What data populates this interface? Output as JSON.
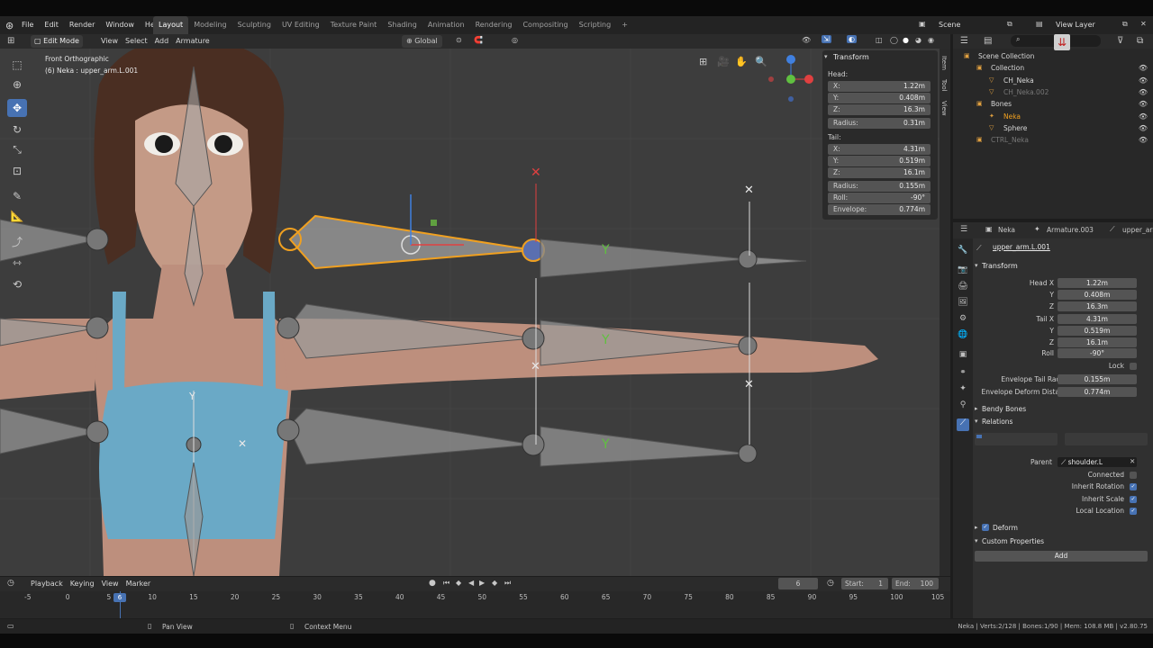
{
  "menubar": {
    "items": [
      "File",
      "Edit",
      "Render",
      "Window",
      "Help"
    ],
    "workspaces": [
      "Layout",
      "Modeling",
      "Sculpting",
      "UV Editing",
      "Texture Paint",
      "Shading",
      "Animation",
      "Rendering",
      "Compositing",
      "Scripting"
    ],
    "active_workspace": "Layout",
    "add_tab": "+",
    "scene_label": "Scene",
    "view_layer_label": "View Layer"
  },
  "viewport_header": {
    "mode": "Edit Mode",
    "menus": [
      "View",
      "Select",
      "Add",
      "Armature"
    ],
    "orientation": "Global"
  },
  "viewport": {
    "view_name": "Front Orthographic",
    "object_info": "(6) Neka : upper_arm.L.001",
    "side_tabs": [
      "Item",
      "Tool",
      "View"
    ]
  },
  "transform_panel": {
    "title": "Transform",
    "head_label": "Head:",
    "tail_label": "Tail:",
    "head": [
      {
        "label": "X:",
        "value": "1.22m"
      },
      {
        "label": "Y:",
        "value": "0.408m"
      },
      {
        "label": "Z:",
        "value": "16.3m"
      },
      {
        "label": "Radius:",
        "value": "0.31m"
      }
    ],
    "tail": [
      {
        "label": "X:",
        "value": "4.31m"
      },
      {
        "label": "Y:",
        "value": "0.519m"
      },
      {
        "label": "Z:",
        "value": "16.1m"
      },
      {
        "label": "Radius:",
        "value": "0.155m"
      },
      {
        "label": "Roll:",
        "value": "-90°"
      },
      {
        "label": "Envelope:",
        "value": "0.774m"
      }
    ]
  },
  "outliner": {
    "rows": [
      {
        "name": "Scene Collection",
        "indent": 0
      },
      {
        "name": "Collection",
        "indent": 1
      },
      {
        "name": "CH_Neka",
        "indent": 2
      },
      {
        "name": "CH_Neka.002",
        "indent": 2
      },
      {
        "name": "Bones",
        "indent": 1
      },
      {
        "name": "Neka",
        "indent": 2
      },
      {
        "name": "Sphere",
        "indent": 2
      },
      {
        "name": "CTRL_Neka",
        "indent": 1
      }
    ]
  },
  "properties": {
    "breadcrumb": [
      "Neka",
      "Armature.003",
      "upper_arm"
    ],
    "bone_name": "upper_arm.L.001",
    "transform_title": "Transform",
    "rows": [
      {
        "label": "Head X",
        "value": "1.22m"
      },
      {
        "label": "Y",
        "value": "0.408m"
      },
      {
        "label": "Z",
        "value": "16.3m"
      },
      {
        "label": "Tail X",
        "value": "4.31m"
      },
      {
        "label": "Y",
        "value": "0.519m"
      },
      {
        "label": "Z",
        "value": "16.1m"
      },
      {
        "label": "Roll",
        "value": "-90°"
      }
    ],
    "lock_label": "Lock",
    "envelope_tail_radius_label": "Envelope Tail Radius",
    "envelope_tail_radius": "0.155m",
    "envelope_deform_label": "Envelope Deform Distan...",
    "envelope_deform": "0.774m",
    "bendy_bones": "Bendy Bones",
    "relations": "Relations",
    "parent_label": "Parent",
    "parent_value": "shoulder.L",
    "connected": "Connected",
    "inherit_rotation": "Inherit Rotation",
    "inherit_scale": "Inherit Scale",
    "local_location": "Local Location",
    "deform": "Deform",
    "custom_properties": "Custom Properties",
    "add": "Add"
  },
  "timeline": {
    "menus": [
      "Playback",
      "Keying",
      "View",
      "Marker"
    ],
    "current_frame": "6",
    "start_label": "Start:",
    "start": "1",
    "end_label": "End:",
    "end": "100",
    "ticks": [
      "-5",
      "0",
      "5",
      "10",
      "15",
      "20",
      "25",
      "30",
      "35",
      "40",
      "45",
      "50",
      "55",
      "60",
      "65",
      "70",
      "75",
      "80",
      "85",
      "90",
      "95",
      "100",
      "105"
    ]
  },
  "statusbar": {
    "pan_view": "Pan View",
    "context_menu": "Context Menu",
    "stats": "Neka | Verts:2/128 | Bones:1/90 | Mem: 108.8 MB | v2.80.75"
  },
  "colors": {
    "accent": "#4772b3",
    "selected_bone": "#f0a020",
    "axis_x": "#e04040",
    "axis_y": "#60c040",
    "axis_z": "#4080e0"
  }
}
